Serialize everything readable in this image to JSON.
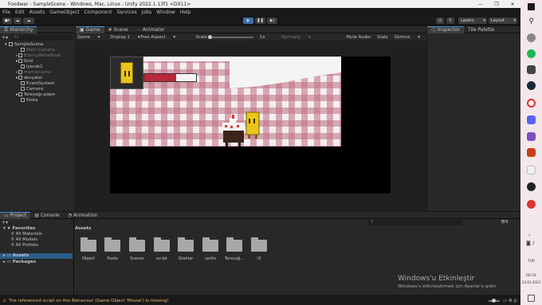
{
  "window": {
    "title": "Foodwar - SampleScene - Windows, Mac, Linux - Unity 2022.1.13f1 <DX11>"
  },
  "menu": [
    "File",
    "Edit",
    "Assets",
    "GameObject",
    "Component",
    "Services",
    "Jobs",
    "Window",
    "Help"
  ],
  "toolbar": {
    "layers": "Layers",
    "layout": "Layout"
  },
  "hierarchy": {
    "tab": "Hierarchy",
    "search_placeholder": "All",
    "scene": "SampleScene",
    "items": [
      "Main Camera",
      "EnemyWaveBook",
      "Grid",
      "içecek1",
      "mamamama",
      "devçatal",
      "EventSystem",
      "Camera",
      "Tereyağı-adam",
      "Pasta"
    ]
  },
  "center_tabs": [
    "Game",
    "Scene",
    "Animator"
  ],
  "game_toolbar": {
    "mode": "Game",
    "display": "Display 1",
    "aspect": "Free Aspect",
    "scale_label": "Scale",
    "scale_value": "1x",
    "play_focused": "Normally",
    "mute": "Mute Audio",
    "stats": "Stats",
    "gizmos": "Gizmos"
  },
  "game_view": {
    "health_fraction": 0.62
  },
  "inspector_tabs": [
    "Inspector",
    "Tile Palette"
  ],
  "bottom_tabs": [
    "Project",
    "Console",
    "Animation"
  ],
  "project": {
    "favorites": "Favorites",
    "favorites_items": [
      "All Materials",
      "All Models",
      "All Prefabs"
    ],
    "assets": "Assets",
    "packages": "Packages",
    "breadcrumb": "Assets",
    "folders": [
      "Object",
      "Pasta",
      "Scenes",
      "script",
      "Silahlar",
      "sprite",
      "Tereyağ...",
      "UI"
    ],
    "asset_count": "8"
  },
  "activation": {
    "title": "Windows'u Etkinleştir",
    "subtitle": "Windows'u etkinleştirmek için Ayarlar'a gidin."
  },
  "status": {
    "message": "The referenced script on this Behaviour (Game Object 'Mouse') is missing!"
  },
  "taskbar": {
    "lang": "TUR",
    "time": "00:31",
    "date": "24.01.2023"
  }
}
